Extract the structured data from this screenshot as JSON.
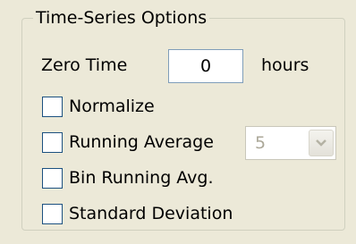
{
  "group": {
    "title": "Time-Series Options"
  },
  "zero_time": {
    "label": "Zero Time",
    "value": "0",
    "unit": "hours"
  },
  "options": [
    {
      "label": "Normalize",
      "checked": false
    },
    {
      "label": "Running Average",
      "checked": false
    },
    {
      "label": "Bin Running Avg.",
      "checked": false
    },
    {
      "label": "Standard Deviation",
      "checked": false
    }
  ],
  "running_average_select": {
    "selected": "5",
    "enabled": false
  },
  "icons": {
    "dropdown": "chevron-down-icon"
  },
  "colors": {
    "background": "#ece9d8",
    "checkbox_border": "#1c5180",
    "input_border": "#7f9db9",
    "disabled_text": "#aca899"
  }
}
